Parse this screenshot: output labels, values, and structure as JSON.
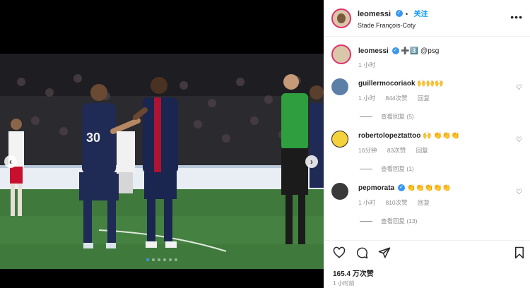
{
  "post": {
    "username": "leomessi",
    "follow_label": "关注",
    "location": "Stade François-Coty",
    "more_label": "•••",
    "caption_text": "➕3️⃣ @psg",
    "caption_time": "1 小时",
    "likes": "165.4 万次赞",
    "posted_time": "1 小时前",
    "carousel": {
      "count": 6,
      "active_index": 0
    }
  },
  "colors": {
    "accent_blue": "#0095f6",
    "verified_blue": "#3897f0",
    "muted_text": "#8e8e8e"
  },
  "icons": {
    "like": "heart-icon",
    "comment": "comment-icon",
    "share": "paper-plane-icon",
    "save": "bookmark-icon",
    "verified": "verified-badge-icon",
    "more": "more-horizontal-icon"
  },
  "comments": [
    {
      "username": "guillermocoriaok",
      "text": "🙌🙌🙌",
      "time": "1 小时",
      "likes": "844次赞",
      "reply_label": "回复",
      "view_replies": "查看回复 (5)"
    },
    {
      "username": "robertolopeztattoo",
      "text": "🙌 👏👏👏",
      "time": "16分钟",
      "likes": "83次赞",
      "reply_label": "回复",
      "view_replies": "查看回复 (1)"
    },
    {
      "username": "pepmorata",
      "text": "👏👏👏👏👏",
      "time": "1 小时",
      "likes": "810次赞",
      "reply_label": "回复",
      "view_replies": "查看回复 (13)"
    }
  ]
}
